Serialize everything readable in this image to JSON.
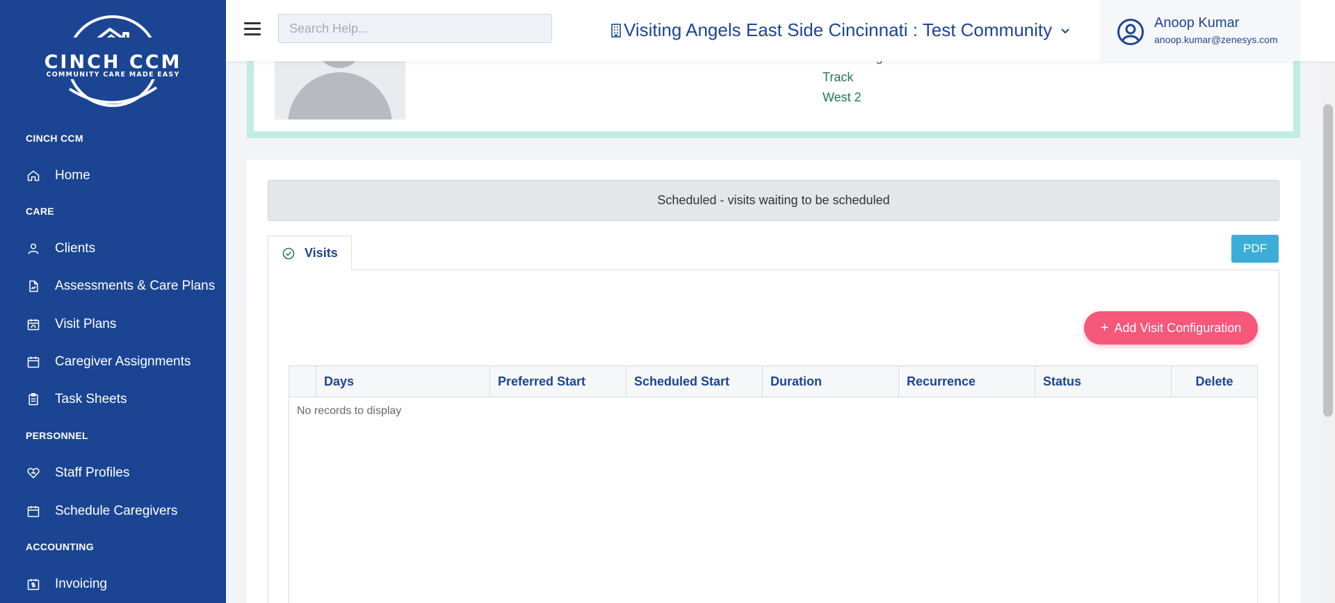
{
  "sidebar": {
    "logo": {
      "main": "CINCH CCM",
      "tagline": "COMMUNITY CARE MADE EASY"
    },
    "sections": [
      {
        "title": "CINCH CCM",
        "items": [
          {
            "label": "Home",
            "icon": "home-icon"
          }
        ]
      },
      {
        "title": "CARE",
        "items": [
          {
            "label": "Clients",
            "icon": "user-icon"
          },
          {
            "label": "Assessments & Care Plans",
            "icon": "document-chart-icon"
          },
          {
            "label": "Visit Plans",
            "icon": "calendar-home-icon"
          },
          {
            "label": "Caregiver Assignments",
            "icon": "calendar-icon"
          },
          {
            "label": "Task Sheets",
            "icon": "clipboard-icon"
          }
        ]
      },
      {
        "title": "PERSONNEL",
        "items": [
          {
            "label": "Staff Profiles",
            "icon": "heart-icon"
          },
          {
            "label": "Schedule Caregivers",
            "icon": "calendar-icon"
          }
        ]
      },
      {
        "title": "ACCOUNTING",
        "items": [
          {
            "label": "Invoicing",
            "icon": "invoice-calendar-icon"
          }
        ]
      }
    ]
  },
  "header": {
    "search_placeholder": "Search Help...",
    "community": "Visiting Angels East Side Cincinnati : Test Community",
    "user": {
      "name": "Anoop Kumar",
      "email": "anoop.kumar@zenesys.com"
    }
  },
  "profile": {
    "locations": [
      "West Wing",
      "Track",
      "West 2"
    ]
  },
  "main": {
    "banner": "Scheduled - visits waiting to be scheduled",
    "tab_label": "Visits",
    "pdf_label": "PDF",
    "add_button_label": "Add Visit Configuration",
    "grid": {
      "columns": [
        "Days",
        "Preferred Start",
        "Scheduled Start",
        "Duration",
        "Recurrence",
        "Status",
        "Delete"
      ],
      "empty_message": "No records to display"
    }
  },
  "colors": {
    "sidebar": "#1b4593",
    "accent_pink": "#f5587a",
    "pdf_blue": "#3aaed8",
    "location_green": "#1f7a4d",
    "card_border": "#bfeee0"
  }
}
